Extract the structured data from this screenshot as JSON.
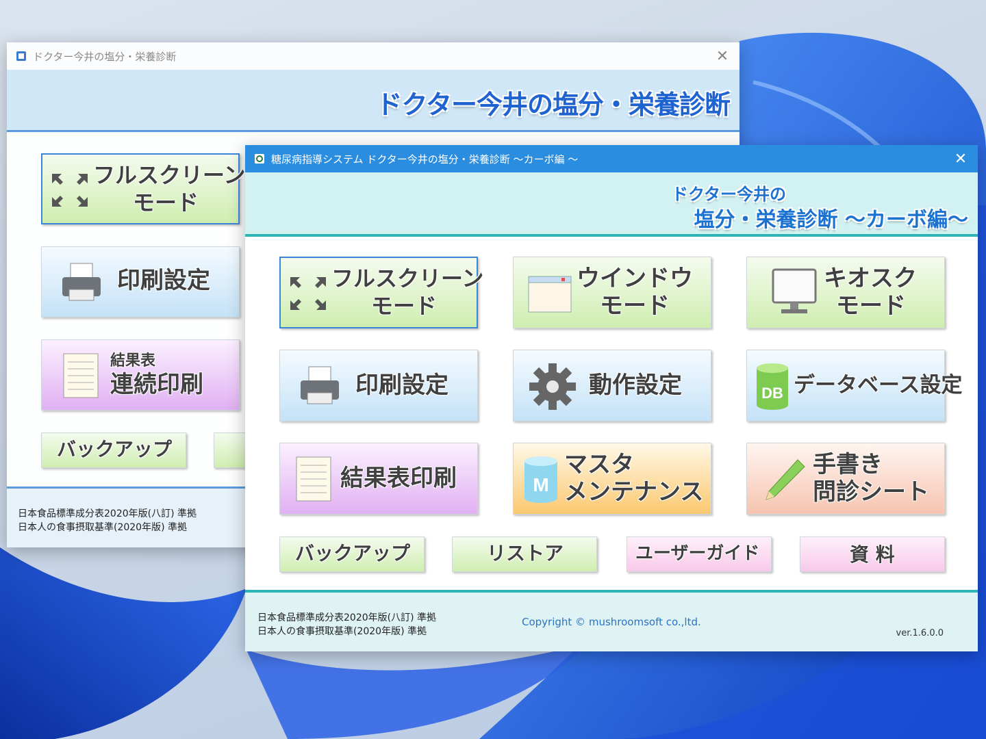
{
  "back_window": {
    "title": "ドクター今井の塩分・栄養診断",
    "banner_title": "ドクター今井の塩分・栄養診断",
    "buttons": {
      "fullscreen_line1": "フルスクリーン",
      "fullscreen_line2": "モード",
      "print_settings": "印刷設定",
      "results_line1": "結果表",
      "results_line2": "連続印刷",
      "backup": "バックアップ"
    },
    "footer": {
      "note1": "日本食品標準成分表2020年版(八訂) 準拠",
      "note2": "日本人の食事摂取基準(2020年版) 準拠"
    }
  },
  "front_window": {
    "title": "糖尿病指導システム ドクター今井の塩分・栄養診断 ～カーボ編 ～",
    "banner_line1": "ドクター今井の",
    "banner_line2": "塩分・栄養診断 ～カーボ編～",
    "buttons": {
      "fullscreen_line1": "フルスクリーン",
      "fullscreen_line2": "モード",
      "window_line1": "ウインドウ",
      "window_line2": "モード",
      "kiosk_line1": "キオスク",
      "kiosk_line2": "モード",
      "print_settings": "印刷設定",
      "operation_settings": "動作設定",
      "database_settings": "データベース設定",
      "results_print": "結果表印刷",
      "master_line1": "マスタ",
      "master_line2": "メンテナンス",
      "handwritten_line1": "手書き",
      "handwritten_line2": "問診シート",
      "backup": "バックアップ",
      "restore": "リストア",
      "user_guide": "ユーザーガイド",
      "materials": "資 料"
    },
    "icon_text": {
      "db": "DB",
      "m": "M"
    },
    "footer": {
      "note1": "日本食品標準成分表2020年版(八訂) 準拠",
      "note2": "日本人の食事摂取基準(2020年版) 準拠",
      "copyright": "Copyright © mushroomsoft co.,ltd.",
      "version": "ver.1.6.0.0"
    }
  },
  "close_glyph": "✕"
}
